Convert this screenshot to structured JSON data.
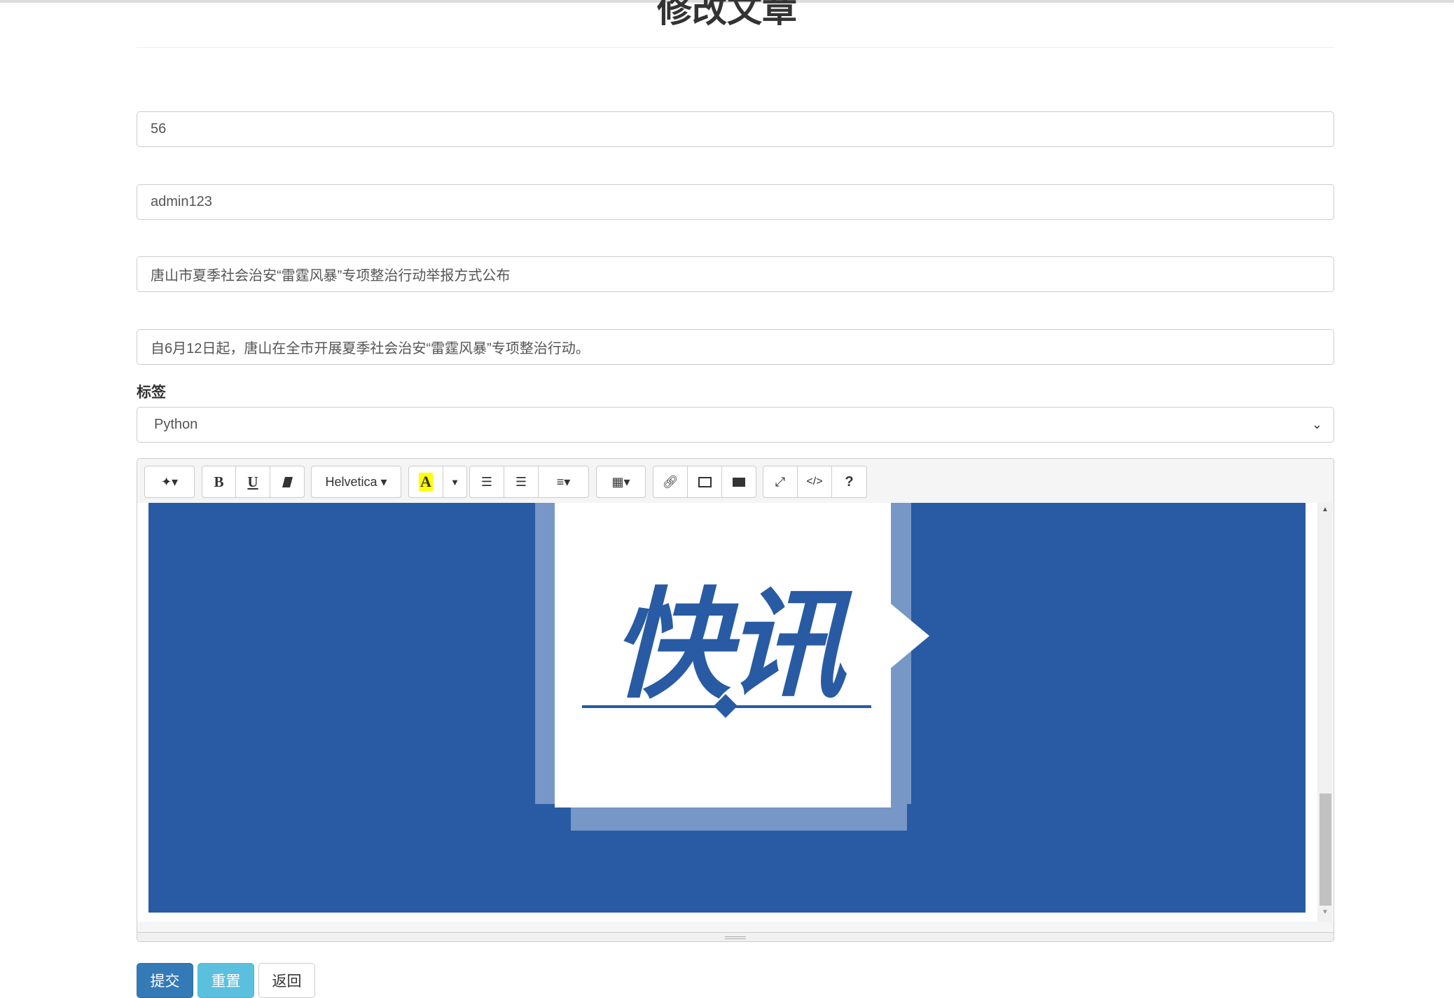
{
  "page": {
    "title": "修改文章"
  },
  "form": {
    "id_value": "56",
    "author_value": "admin123",
    "title_value": "唐山市夏季社会治安“雷霆风暴”专项整治行动举报方式公布",
    "summary_value": "自6月12日起，唐山在全市开展夏季社会治安“雷霆风暴”专项整治行动。",
    "tag_label": "标签",
    "tag_selected": "Python"
  },
  "editor": {
    "toolbar": {
      "font_name": "Helvetica",
      "highlight_letter": "A",
      "code_label": "</>",
      "help_label": "?",
      "bold": "B",
      "underline": "U"
    },
    "image": {
      "text": "快讯",
      "background": "#285ba3"
    }
  },
  "buttons": {
    "submit": "提交",
    "reset": "重置",
    "back": "返回"
  },
  "colors": {
    "primary": "#337ab7",
    "info": "#5bc0de"
  }
}
